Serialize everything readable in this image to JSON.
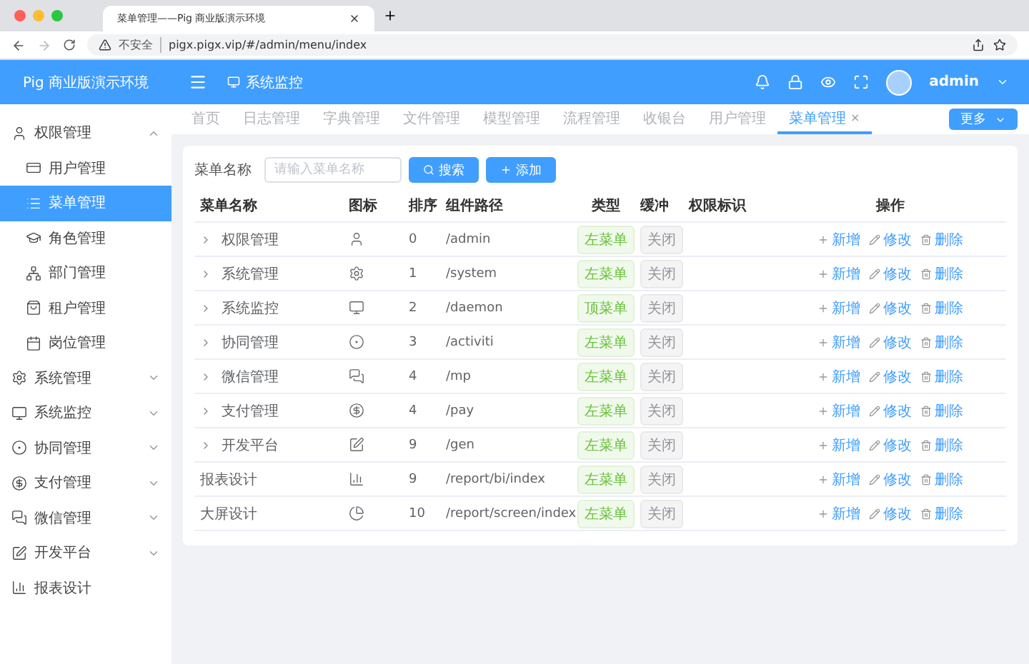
{
  "browser": {
    "tab_title": "菜单管理——Pig 商业版演示环境",
    "security": "不安全",
    "url": "pigx.pigx.vip/#/admin/menu/index"
  },
  "header": {
    "logo": "Pig 商业版演示环境",
    "breadcrumb": "系统监控",
    "user": "admin"
  },
  "sidebar": {
    "items": [
      {
        "label": "权限管理",
        "expanded": true,
        "selected": false,
        "children": [
          {
            "label": "用户管理",
            "selected": false
          },
          {
            "label": "菜单管理",
            "selected": true
          },
          {
            "label": "角色管理",
            "selected": false
          },
          {
            "label": "部门管理",
            "selected": false
          },
          {
            "label": "租户管理",
            "selected": false
          },
          {
            "label": "岗位管理",
            "selected": false
          }
        ]
      },
      {
        "label": "系统管理",
        "expanded": false,
        "selected": false
      },
      {
        "label": "系统监控",
        "expanded": false,
        "selected": false
      },
      {
        "label": "协同管理",
        "expanded": false,
        "selected": false
      },
      {
        "label": "支付管理",
        "expanded": false,
        "selected": false
      },
      {
        "label": "微信管理",
        "expanded": false,
        "selected": false
      },
      {
        "label": "开发平台",
        "expanded": false,
        "selected": false
      },
      {
        "label": "报表设计",
        "selected": false
      }
    ]
  },
  "tabs": [
    {
      "label": "首页",
      "selected": false
    },
    {
      "label": "日志管理",
      "selected": false
    },
    {
      "label": "字典管理",
      "selected": false
    },
    {
      "label": "文件管理",
      "selected": false
    },
    {
      "label": "模型管理",
      "selected": false
    },
    {
      "label": "流程管理",
      "selected": false
    },
    {
      "label": "收银台",
      "selected": false
    },
    {
      "label": "用户管理",
      "selected": false
    },
    {
      "label": "菜单管理",
      "selected": true,
      "close": "×"
    }
  ],
  "more_button": "更多",
  "search": {
    "label": "菜单名称",
    "placeholder": "请输入菜单名称",
    "search_button": "搜索",
    "add_button": "添加"
  },
  "table": {
    "columns": [
      "菜单名称",
      "图标",
      "排序",
      "组件路径",
      "类型",
      "缓冲",
      "权限标识",
      "操作"
    ],
    "rows": [
      {
        "name": "权限管理",
        "expandable": true,
        "order": "0",
        "path": "/admin",
        "type": "左菜单",
        "cache": "关闭",
        "actions": [
          "新增",
          "修改",
          "删除"
        ]
      },
      {
        "name": "系统管理",
        "expandable": true,
        "order": "1",
        "path": "/system",
        "type": "左菜单",
        "cache": "关闭",
        "actions": [
          "新增",
          "修改",
          "删除"
        ]
      },
      {
        "name": "系统监控",
        "expandable": true,
        "order": "2",
        "path": "/daemon",
        "type": "顶菜单",
        "cache": "关闭",
        "actions": [
          "新增",
          "修改",
          "删除"
        ]
      },
      {
        "name": "协同管理",
        "expandable": true,
        "order": "3",
        "path": "/activiti",
        "type": "左菜单",
        "cache": "关闭",
        "actions": [
          "新增",
          "修改",
          "删除"
        ]
      },
      {
        "name": "微信管理",
        "expandable": true,
        "order": "4",
        "path": "/mp",
        "type": "左菜单",
        "cache": "关闭",
        "actions": [
          "新增",
          "修改",
          "删除"
        ]
      },
      {
        "name": "支付管理",
        "expandable": true,
        "order": "4",
        "path": "/pay",
        "type": "左菜单",
        "cache": "关闭",
        "actions": [
          "新增",
          "修改",
          "删除"
        ]
      },
      {
        "name": "开发平台",
        "expandable": true,
        "order": "9",
        "path": "/gen",
        "type": "左菜单",
        "cache": "关闭",
        "actions": [
          "新增",
          "修改",
          "删除"
        ]
      },
      {
        "name": "报表设计",
        "expandable": false,
        "order": "9",
        "path": "/report/bi/index",
        "type": "左菜单",
        "cache": "关闭",
        "actions": [
          "新增",
          "修改",
          "删除"
        ]
      },
      {
        "name": "大屏设计",
        "expandable": false,
        "order": "10",
        "path": "/report/screen/index",
        "type": "左菜单",
        "cache": "关闭",
        "actions": [
          "新增",
          "修改",
          "删除"
        ]
      }
    ]
  }
}
